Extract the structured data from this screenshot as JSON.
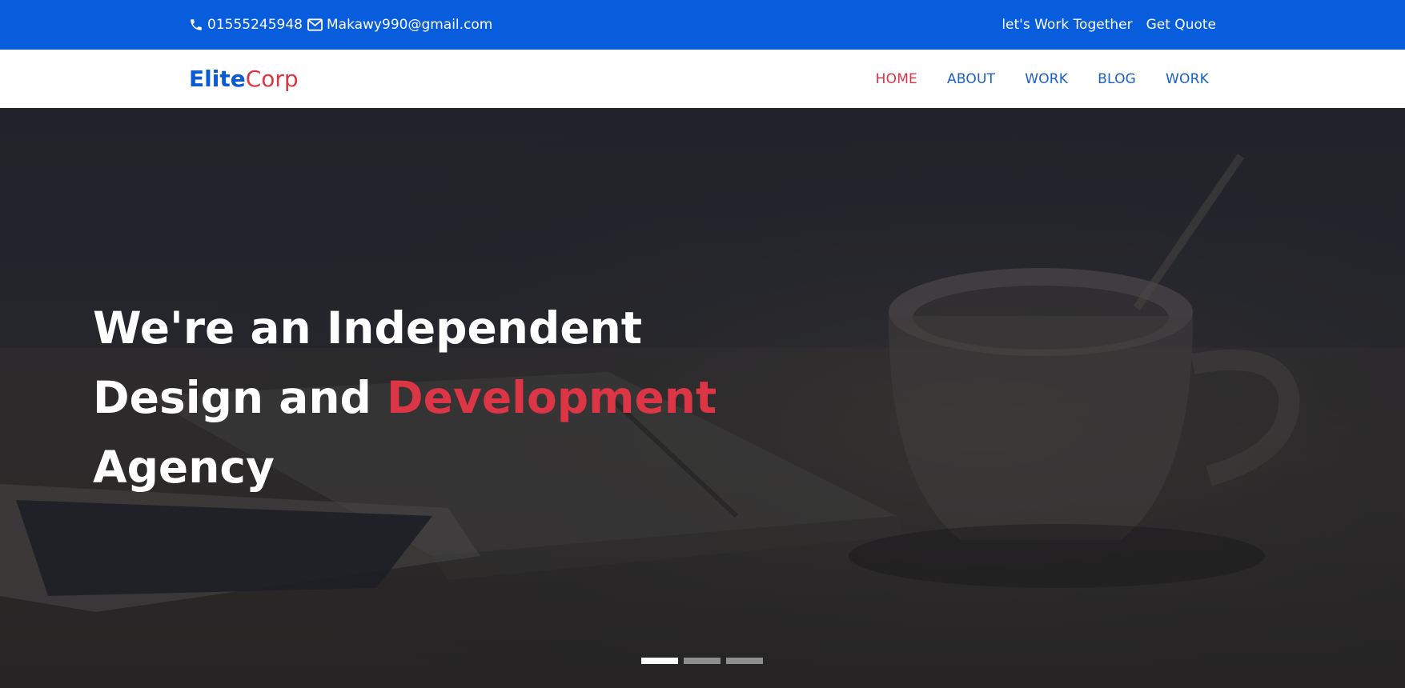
{
  "topbar": {
    "phone": "01555245948",
    "email": "Makawy990@gmail.com",
    "phone_icon": "phone-icon",
    "email_icon": "envelope-icon",
    "work_together": "let's Work Together",
    "get_quote": "Get Quote",
    "color": "#075ddb"
  },
  "navbar": {
    "brand_part1": "Elite",
    "brand_part2": "Corp",
    "items": [
      {
        "label": "HOME",
        "active": true
      },
      {
        "label": "ABOUT",
        "active": false
      },
      {
        "label": "WORK",
        "active": false
      },
      {
        "label": "BLOG",
        "active": false
      },
      {
        "label": "WORK",
        "active": false
      }
    ]
  },
  "hero": {
    "line1": "We're an Independent",
    "line2_prefix": "Design and ",
    "line2_accent": "Development",
    "line3": "Agency",
    "accent_color": "#dc3545",
    "background": "dimmed desk photo with coffee cup, smartphone and notebook",
    "slides": 3,
    "active_slide": 1
  }
}
